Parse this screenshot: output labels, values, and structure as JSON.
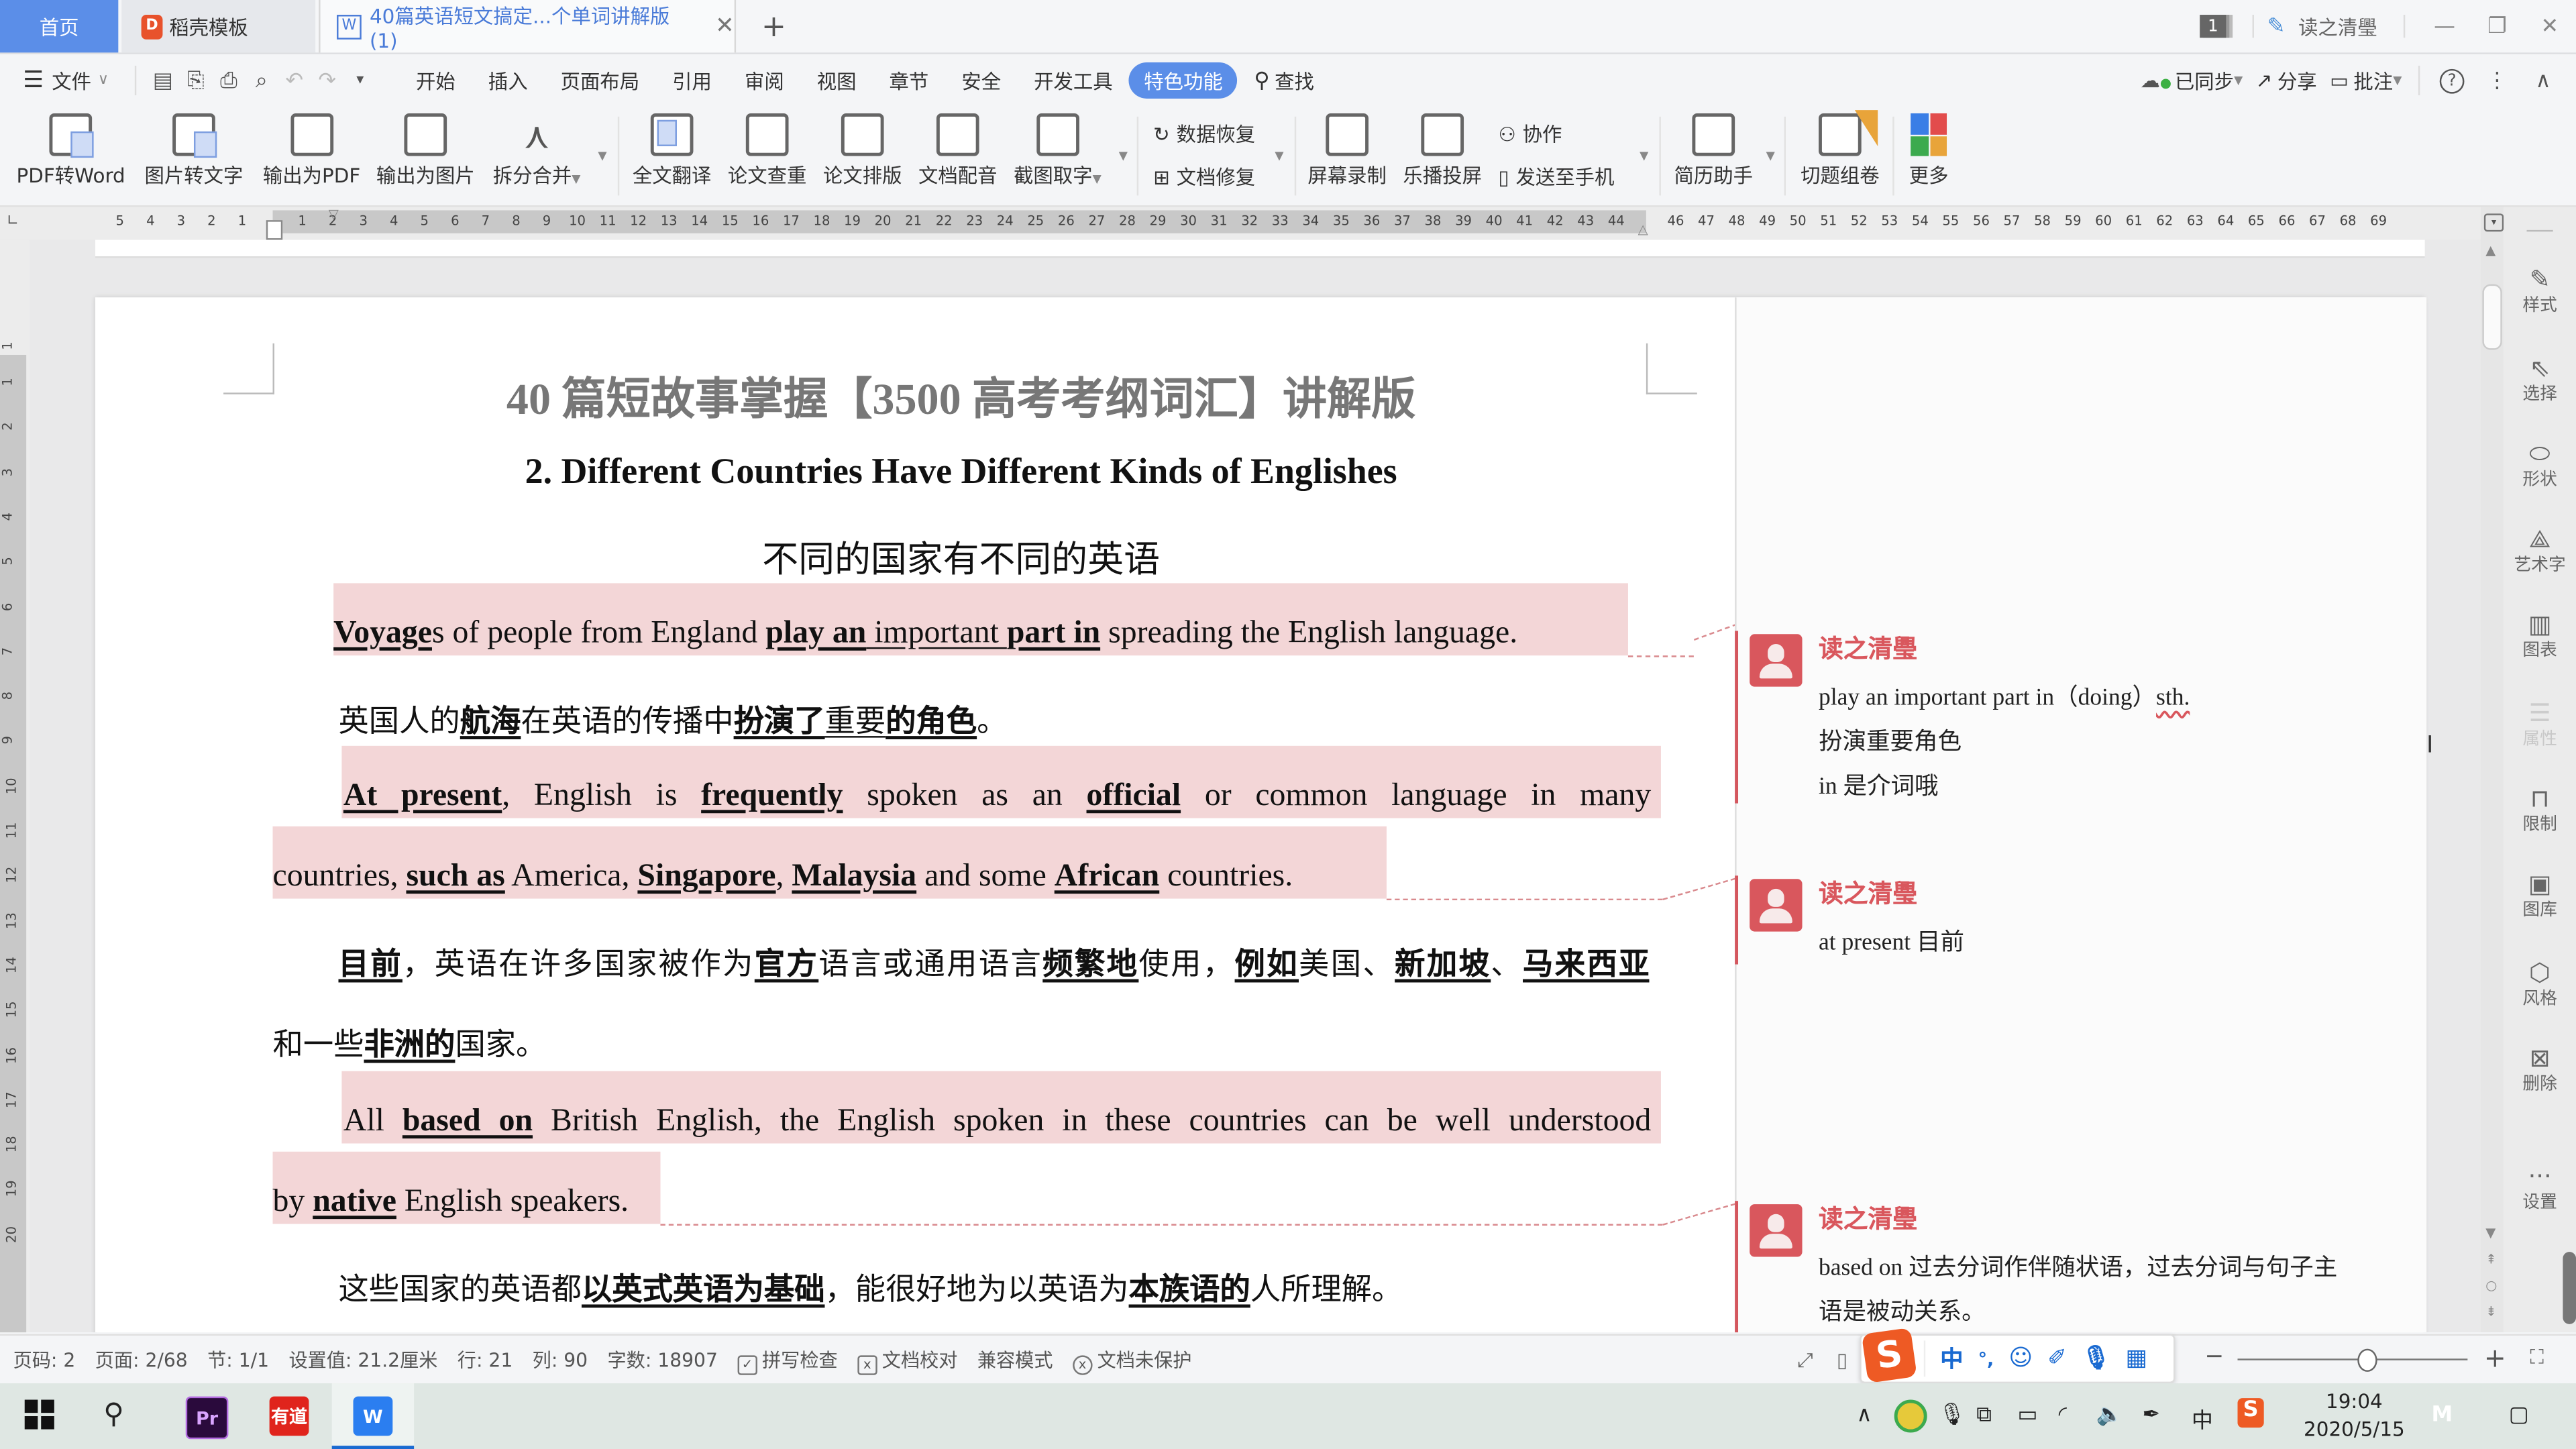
{
  "tabs": {
    "home": "首页",
    "daoke": "稻壳模板",
    "document": "40篇英语短文搞定...个单词讲解版(1)",
    "close_icon": "close-icon",
    "add_icon": "plus-icon"
  },
  "window": {
    "badge_count": "1",
    "user_name": "读之清璺",
    "minimize": "—",
    "restore": "❐",
    "close": "✕"
  },
  "menu": {
    "file": "文件",
    "items": [
      "开始",
      "插入",
      "页面布局",
      "引用",
      "审阅",
      "视图",
      "章节",
      "安全",
      "开发工具",
      "特色功能"
    ],
    "active": "特色功能",
    "search": "查找",
    "synced": "已同步",
    "share": "分享",
    "comment": "批注"
  },
  "ribbon": {
    "buttons": [
      {
        "label": "PDF转Word",
        "icon": "pdf-to-word-icon"
      },
      {
        "label": "图片转文字",
        "icon": "image-to-text-icon"
      },
      {
        "label": "输出为PDF",
        "icon": "export-pdf-icon"
      },
      {
        "label": "输出为图片",
        "icon": "export-image-icon"
      },
      {
        "label": "拆分合并",
        "icon": "split-merge-icon"
      },
      {
        "label": "全文翻译",
        "icon": "translate-icon"
      },
      {
        "label": "论文查重",
        "icon": "plagiarism-check-icon"
      },
      {
        "label": "论文排版",
        "icon": "paper-layout-icon"
      },
      {
        "label": "文档配音",
        "icon": "doc-voice-icon"
      },
      {
        "label": "截图取字",
        "icon": "screenshot-ocr-icon"
      },
      {
        "label": "屏幕录制",
        "icon": "screen-record-icon"
      },
      {
        "label": "乐播投屏",
        "icon": "screen-cast-icon"
      },
      {
        "label": "简历助手",
        "icon": "resume-icon"
      },
      {
        "label": "切题组卷",
        "icon": "exam-icon"
      },
      {
        "label": "更多",
        "icon": "more-apps-icon"
      }
    ],
    "small": {
      "data_recovery": "数据恢复",
      "doc_repair": "文档修复",
      "collaborate": "协作",
      "send_to_phone": "发送至手机"
    }
  },
  "ruler": {
    "h_left": [
      "5",
      "4",
      "3",
      "2",
      "1"
    ],
    "h_main": [
      "1",
      "2",
      "3",
      "4",
      "5",
      "6",
      "7",
      "8",
      "9",
      "10",
      "11",
      "12",
      "13",
      "14",
      "15",
      "16",
      "17",
      "18",
      "19",
      "20",
      "21",
      "22",
      "23",
      "24",
      "25",
      "26",
      "27",
      "28",
      "29",
      "30",
      "31",
      "32",
      "33",
      "34",
      "35",
      "36",
      "37",
      "38",
      "39",
      "40",
      "41",
      "42",
      "43",
      "44"
    ],
    "h_right": [
      "46",
      "47",
      "48",
      "49",
      "50",
      "51",
      "52",
      "53",
      "54",
      "55",
      "56",
      "57",
      "58",
      "59",
      "60",
      "61",
      "62",
      "63",
      "64",
      "65",
      "66",
      "67",
      "68",
      "69"
    ],
    "v": [
      "1",
      "1",
      "2",
      "3",
      "4",
      "5",
      "6",
      "7",
      "8",
      "9",
      "10",
      "11",
      "12",
      "13",
      "14",
      "15",
      "16",
      "17",
      "18",
      "19",
      "20"
    ]
  },
  "document": {
    "title": "40 篇短故事掌握【3500 高考考纲词汇】讲解版",
    "heading_en": "2. Different Countries Have Different Kinds of Englishes",
    "heading_zh": "不同的国家有不同的英语",
    "p1": {
      "a": "Voyage",
      "b": "s of people from England ",
      "c": "play an",
      "d": " important ",
      "e": "part in",
      "f": " spreading the English language."
    },
    "p1_zh": {
      "a": "英国人的",
      "b": "航海",
      "c": "在英语的传播中",
      "d": "扮演了",
      "e": "重要",
      "f": "的角色",
      "g": "。"
    },
    "p2_l1": {
      "a": "At present",
      "b": ", English is ",
      "c": "frequently",
      "d": " spoken as an ",
      "e": "official",
      "f": " or common language in many"
    },
    "p2_l2": {
      "a": "countries, ",
      "b": "such as",
      "c": " America, ",
      "d": "Singapore",
      "e": ", ",
      "f": "Malaysia",
      "g": " and some ",
      "h": "African",
      "i": " countries."
    },
    "p2_zh_l1": {
      "a": "目前",
      "b": "，英语在许多国家被作为",
      "c": "官方",
      "d": "语言或通用语言",
      "e": "频繁地",
      "f": "使用，",
      "g": "例如",
      "h": "美国、",
      "i": "新加坡",
      "j": "、",
      "k": "马来西亚"
    },
    "p2_zh_l2": {
      "a": "和一些",
      "b": "非洲的",
      "c": "国家。"
    },
    "p3_l1": {
      "a": "All ",
      "b": "based on",
      "c": " British English, the English spoken in these countries can be well understood"
    },
    "p3_l2": {
      "a": "by ",
      "b": "native",
      "c": " English speakers."
    },
    "p3_zh": {
      "a": "这些国家的英语都",
      "b": "以英式英语为基础",
      "c": "，能很好地为以英语为",
      "d": "本族语的",
      "e": "人所理解。"
    }
  },
  "comments": [
    {
      "author": "读之清璺",
      "lines": [
        "play an important part in（doing）",
        "扮演重要角色",
        "in 是介词哦"
      ],
      "squiggle": "sth."
    },
    {
      "author": "读之清璺",
      "lines": [
        "at present  目前"
      ]
    },
    {
      "author": "读之清璺",
      "lines": [
        "based on 过去分词作伴随状语，过去分词与句子主",
        "语是被动关系。"
      ]
    }
  ],
  "side_panel": [
    {
      "label": "样式",
      "icon": "style-icon",
      "glyph": "✎",
      "enabled": true
    },
    {
      "label": "选择",
      "icon": "select-cursor-icon",
      "glyph": "⇖",
      "enabled": true
    },
    {
      "label": "形状",
      "icon": "shape-icon",
      "glyph": "⬭",
      "enabled": true
    },
    {
      "label": "艺术字",
      "icon": "wordart-icon",
      "glyph": "⟁",
      "enabled": true
    },
    {
      "label": "图表",
      "icon": "chart-icon",
      "glyph": "▥",
      "enabled": true
    },
    {
      "label": "属性",
      "icon": "properties-icon",
      "glyph": "☰",
      "enabled": false
    },
    {
      "label": "限制",
      "icon": "lock-icon",
      "glyph": "⊓",
      "enabled": true
    },
    {
      "label": "图库",
      "icon": "gallery-icon",
      "glyph": "▣",
      "enabled": true
    },
    {
      "label": "风格",
      "icon": "theme-icon",
      "glyph": "⬡",
      "enabled": true
    },
    {
      "label": "删除",
      "icon": "delete-icon",
      "glyph": "⊠",
      "enabled": true
    },
    {
      "label": "设置",
      "icon": "settings-dots-icon",
      "glyph": "···",
      "enabled": true
    }
  ],
  "status": {
    "page_num": "页码: 2",
    "pages": "页面: 2/68",
    "section": "节: 1/1",
    "setting": "设置值: 21.2厘米",
    "row": "行: 21",
    "col": "列: 90",
    "words": "字数: 18907",
    "spell": "拼写检查",
    "proof": "文档校对",
    "compat": "兼容模式",
    "protect": "文档未保护",
    "zoom_level": 0.56
  },
  "ime": {
    "logo": "S",
    "lang": "中",
    "punct": "°,",
    "emoji": "☺",
    "skin": "✐",
    "voice": "🎤",
    "grid": "▦"
  },
  "taskbar": {
    "apps": [
      {
        "name": "premiere-pro",
        "label": "Pr",
        "color": "#2a0a3c"
      },
      {
        "name": "youdao",
        "label": "有道",
        "color": "#e0241c"
      },
      {
        "name": "wps",
        "label": "W",
        "color": "#2b7ef0"
      }
    ],
    "time": "19:04",
    "date": "2020/5/15",
    "ime_tray": "中"
  },
  "colors": {
    "accent": "#5b8ee8",
    "highlight": "#f3d6d7",
    "comment_red": "#d9575d"
  }
}
